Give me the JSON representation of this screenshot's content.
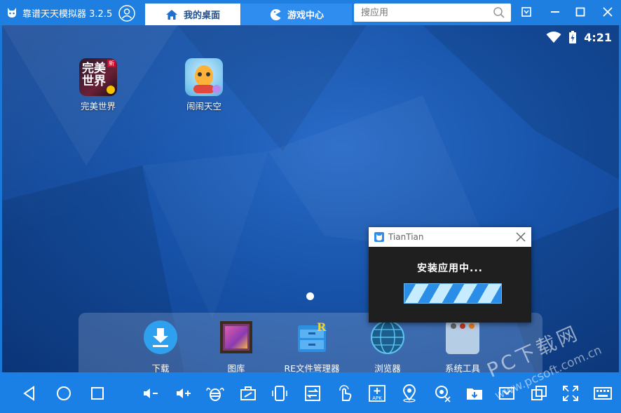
{
  "titlebar": {
    "app_title": "靠谱天天模拟器 3.2.5",
    "tabs": [
      {
        "label": "我的桌面",
        "active": true
      },
      {
        "label": "游戏中心",
        "active": false
      }
    ],
    "search_placeholder": "搜应用"
  },
  "status": {
    "time": "4:21"
  },
  "desktop": {
    "apps": [
      {
        "label": "完美世界",
        "icon": "perfect-world-icon"
      },
      {
        "label": "闹闹天空",
        "icon": "naonao-sky-icon"
      }
    ]
  },
  "dock": {
    "items": [
      {
        "label": "下载",
        "icon": "download-icon"
      },
      {
        "label": "图库",
        "icon": "gallery-icon"
      },
      {
        "label": "RE文件管理器",
        "icon": "re-file-manager-icon"
      },
      {
        "label": "浏览器",
        "icon": "browser-icon"
      },
      {
        "label": "系统工具",
        "icon": "system-tools-folder-icon"
      }
    ]
  },
  "dialog": {
    "title": "TianTian",
    "message": "安装应用中..."
  },
  "toolbar": {
    "apk_label": "APK"
  },
  "watermark": {
    "main": "PC下载网",
    "sub": "www.pcsoft.com.cn"
  },
  "colors": {
    "titlebar": "#1e7fe0",
    "toolbar": "#1a80e6",
    "desktop": "#1753a9"
  }
}
